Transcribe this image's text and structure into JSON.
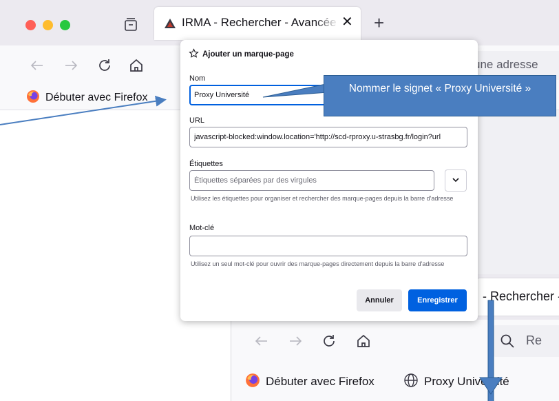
{
  "top_browser": {
    "tab": {
      "title": "IRMA - Rechercher - Avancée sur",
      "close_glyph": "✕",
      "favicon": "irma-favicon"
    },
    "new_tab_glyph": "+",
    "urlbar_text": "une adresse",
    "bookmarks": [
      {
        "label": "Débuter avec Firefox",
        "icon": "firefox-icon"
      }
    ]
  },
  "dialog": {
    "title": "Ajouter un marque-page",
    "title_icon": "star-icon",
    "name_label": "Nom",
    "name_value": "Proxy Université",
    "url_label": "URL",
    "url_value": "javascript-blocked:window.location='http://scd-rproxy.u-strasbg.fr/login?url",
    "tags_label": "Étiquettes",
    "tags_placeholder": "Étiquettes séparées par des virgules",
    "tags_hint": "Utilisez les étiquettes pour organiser et rechercher des marque-pages depuis la barre d'adresse",
    "keyword_label": "Mot-clé",
    "keyword_value": "",
    "keyword_hint": "Utilisez un seul mot-clé pour ouvrir des marque-pages directement depuis la barre d'adresse",
    "cancel_label": "Annuler",
    "save_label": "Enregistrer"
  },
  "callout": {
    "text": "Nommer le signet « Proxy Université »",
    "color": "#4a7ec0"
  },
  "bottom_browser": {
    "tab_title": "- Rechercher -",
    "urlbar_text": "Re",
    "bookmarks": [
      {
        "label": "Débuter avec Firefox",
        "icon": "firefox-icon"
      },
      {
        "label": "Proxy Université",
        "icon": "globe-icon"
      }
    ]
  },
  "colors": {
    "accent": "#0061e0",
    "tabstrip": "#eceaf0",
    "toolbar": "#f9f9fb"
  }
}
